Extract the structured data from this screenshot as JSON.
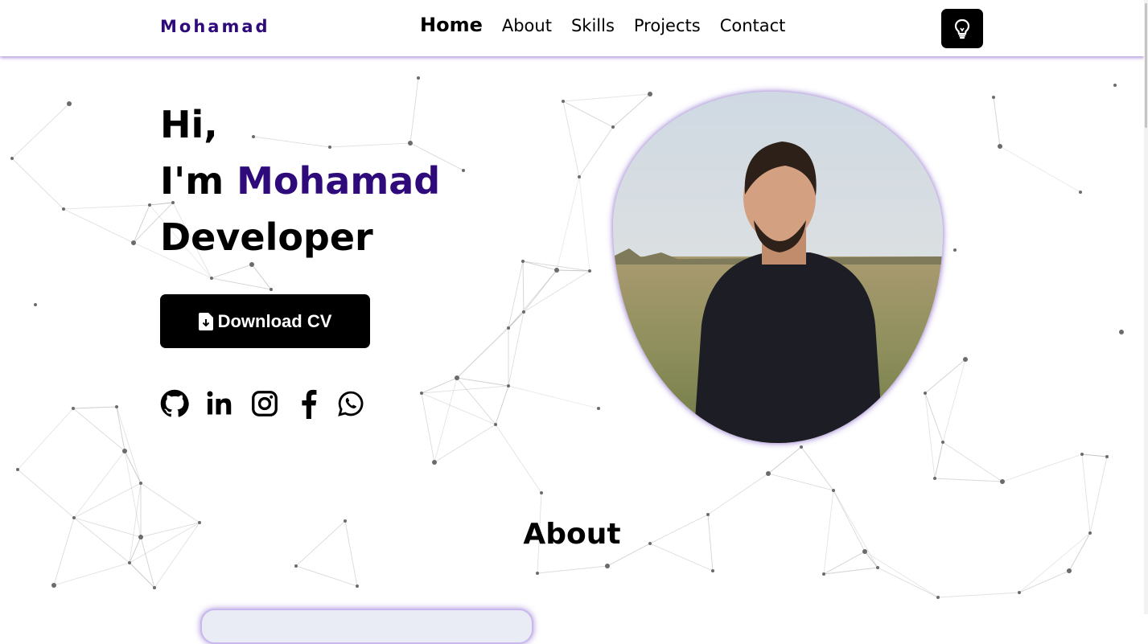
{
  "header": {
    "logo": "Mohamad",
    "nav": [
      "Home",
      "About",
      "Skills",
      "Projects",
      "Contact"
    ],
    "active_nav": "Home",
    "theme_toggle_icon": "lightbulb-icon"
  },
  "hero": {
    "greeting": "Hi,",
    "intro_prefix": "I'm ",
    "name": "Mohamad",
    "role": "Developer",
    "cv_button_label": "Download CV",
    "cv_button_icon": "file-download-icon",
    "socials": [
      "github-icon",
      "linkedin-icon",
      "instagram-icon",
      "facebook-icon",
      "whatsapp-icon"
    ],
    "photo": "profile-photo"
  },
  "about": {
    "title": "About"
  },
  "colors": {
    "accent": "#2e0a7a",
    "glow": "#8a63d2",
    "button_bg": "#000000",
    "network_line": "#a9a9a9"
  }
}
